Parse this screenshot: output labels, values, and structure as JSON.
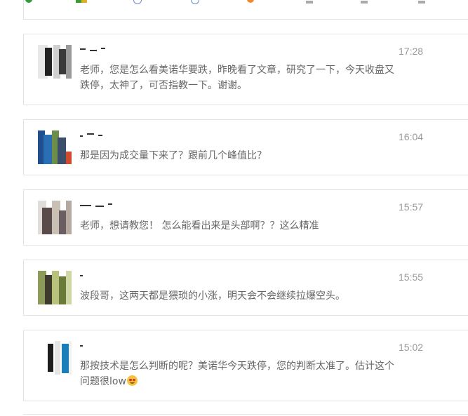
{
  "comments": [
    {
      "time": "17:28",
      "text": "老师，您是怎么看美诺华要跌，昨晚看了文章，研究了一下，今天收盘又跌停，太神了，可否指教一下。谢谢。"
    },
    {
      "time": "16:04",
      "text": "那是因为成交量下来了？跟前几个峰值比？"
    },
    {
      "time": "15:57",
      "text": "老师，想请教您！ 怎么能看出来是头部啊？？这么精准"
    },
    {
      "time": "15:55",
      "text": "波段哥，这两天都是猥琐的小涨，明天会不会继续拉爆空头。"
    },
    {
      "time": "15:02",
      "text": "那按技术是怎么判断的呢？美诺华今天跌停，您的判断太准了。估计这个问题很low",
      "emoji": "smiling-face-with-heart-eyes"
    }
  ],
  "colors": {
    "time": "#999999",
    "text": "#666666",
    "border": "#e3e3e3",
    "emoji": "#f6c23c"
  }
}
